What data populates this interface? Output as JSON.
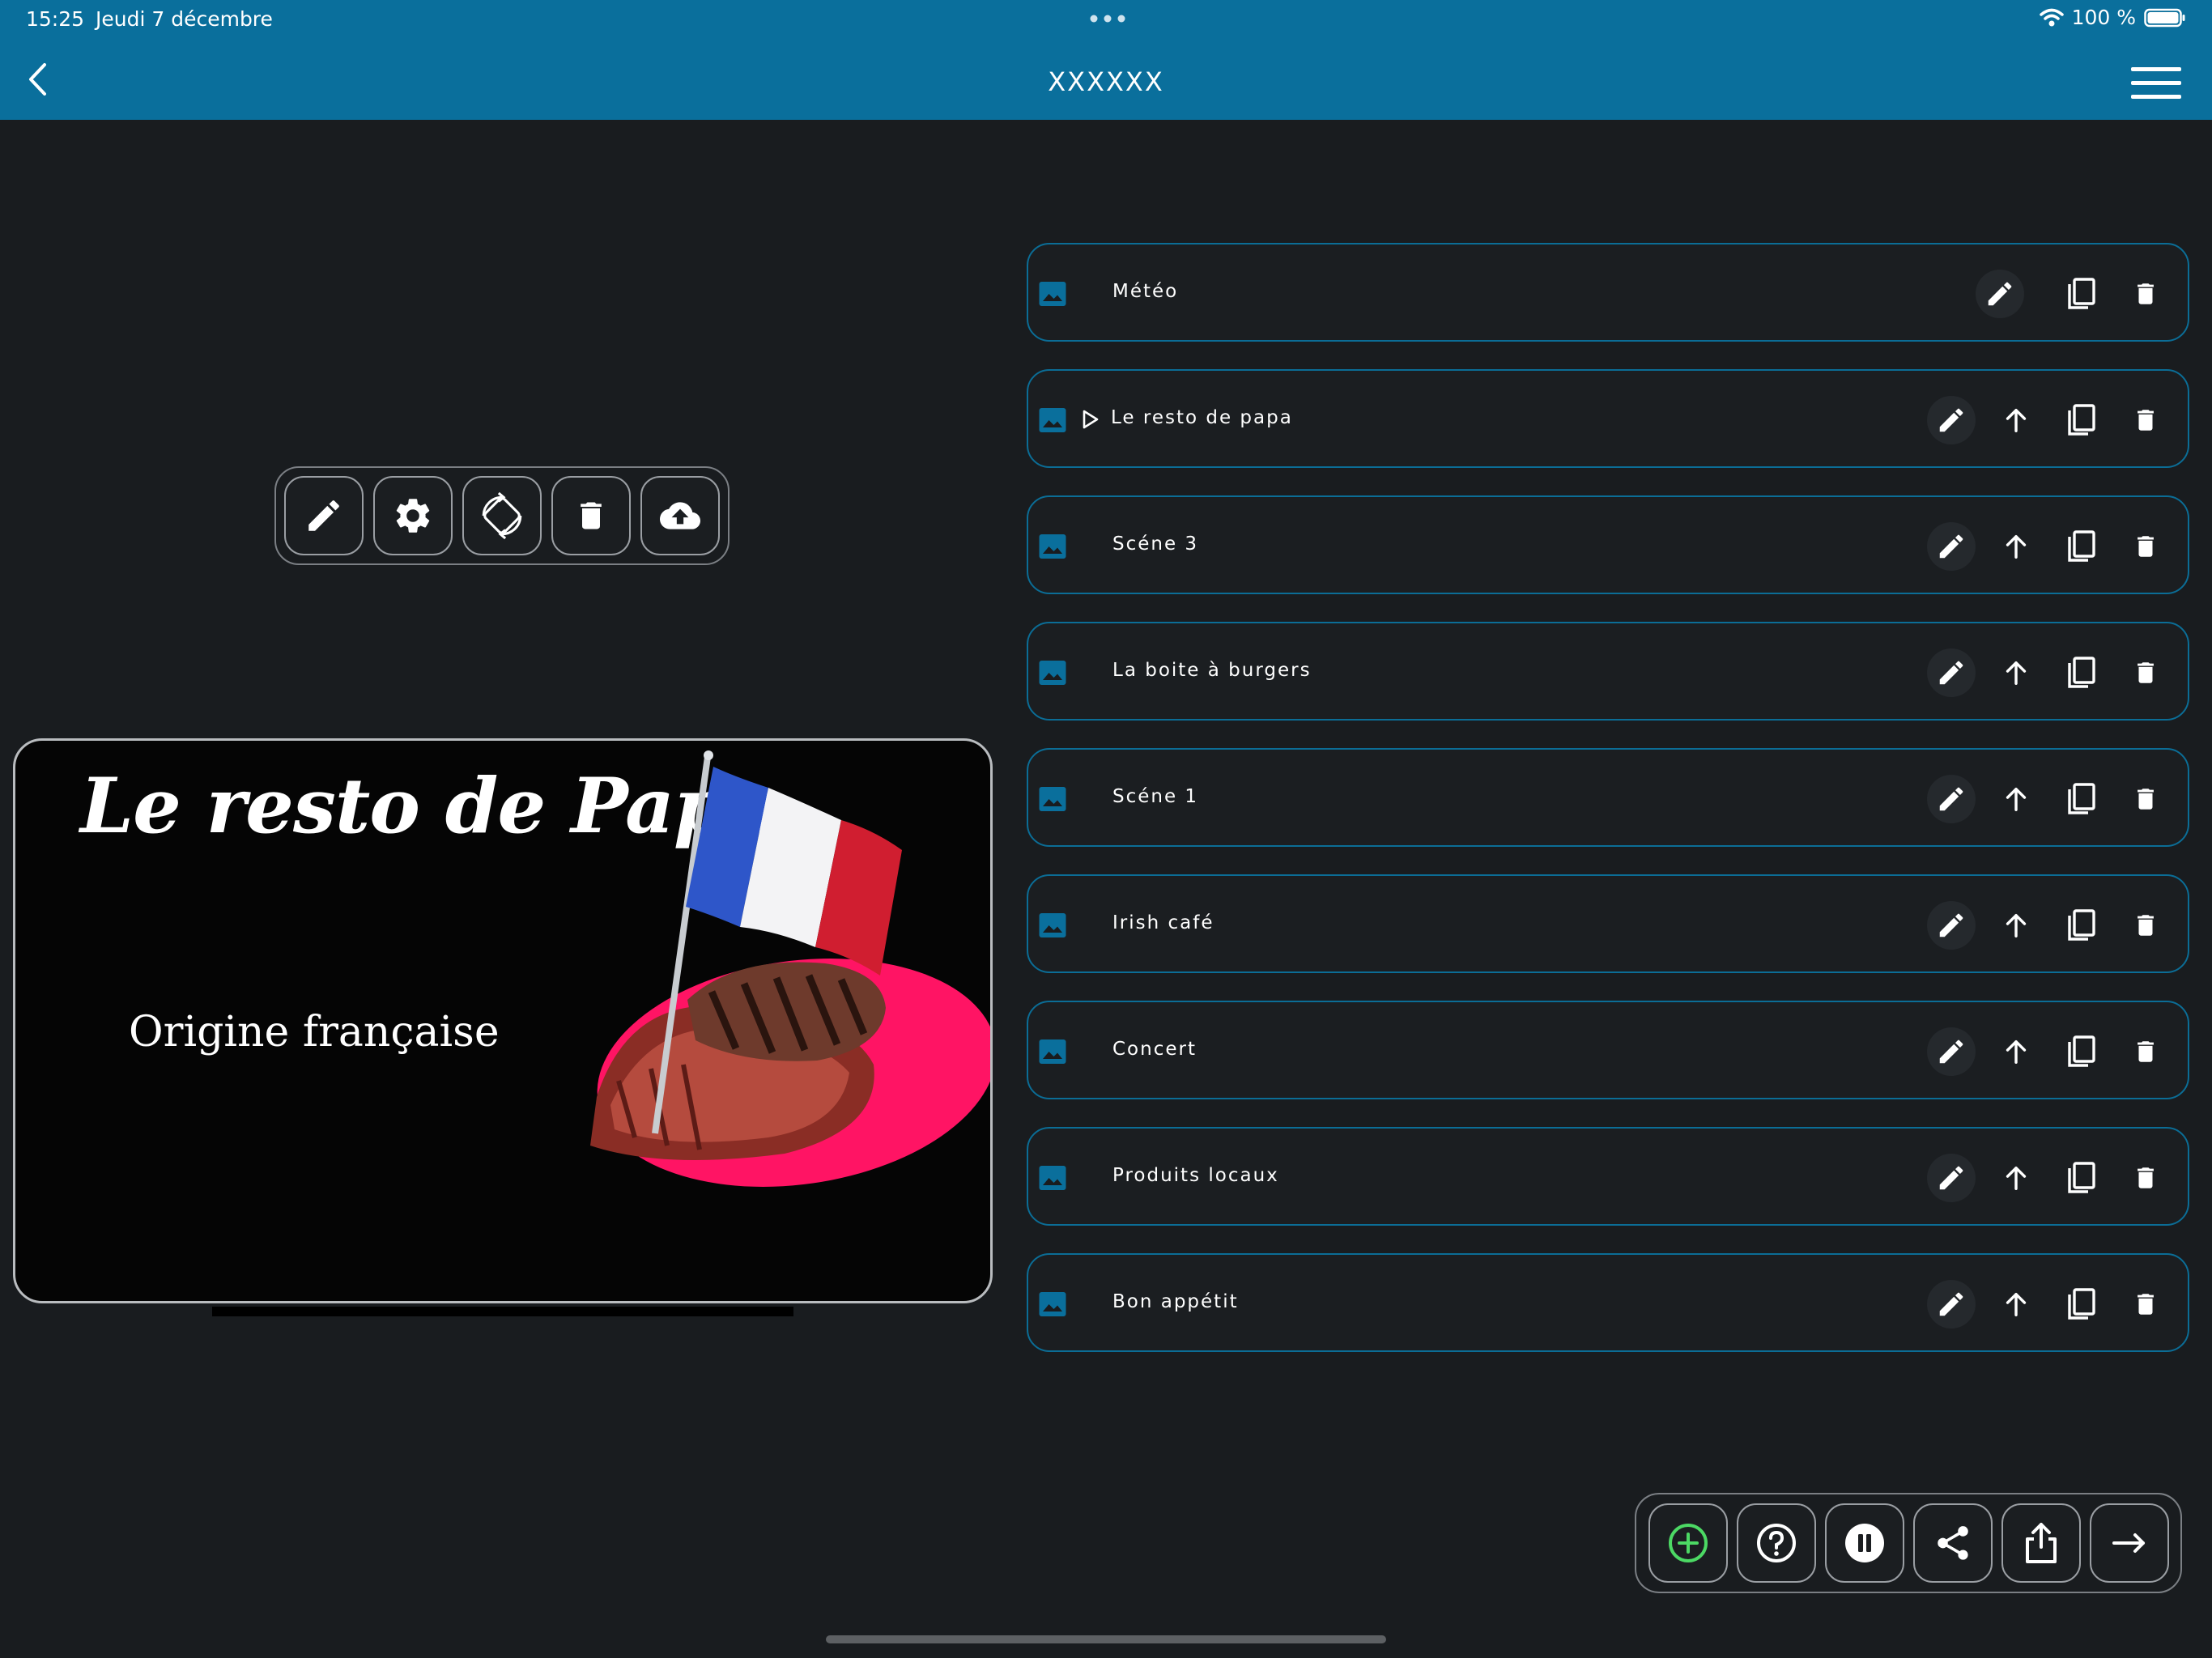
{
  "status_bar": {
    "time": "15:25",
    "date": "Jeudi 7 décembre",
    "battery": "100 %"
  },
  "nav": {
    "title": "XXXXXX"
  },
  "colors": {
    "accent": "#0a6f9c",
    "background": "#191c1f",
    "add_icon": "#4cd964",
    "preview_blob": "#ff1464"
  },
  "toolbar": {
    "icons": [
      "pencil-icon",
      "gear-icon",
      "rotate-icon",
      "trash-icon",
      "cloud-upload-icon"
    ]
  },
  "preview": {
    "title": "Le resto de Papa",
    "subtitle": "Origine française"
  },
  "scenes": [
    {
      "label": "Météo",
      "playing": false,
      "can_move_up": false
    },
    {
      "label": "Le resto de papa",
      "playing": true,
      "can_move_up": true
    },
    {
      "label": "Scéne 3",
      "playing": false,
      "can_move_up": true
    },
    {
      "label": "La boite à burgers",
      "playing": false,
      "can_move_up": true
    },
    {
      "label": "Scéne 1",
      "playing": false,
      "can_move_up": true
    },
    {
      "label": "Irish café",
      "playing": false,
      "can_move_up": true
    },
    {
      "label": "Concert",
      "playing": false,
      "can_move_up": true
    },
    {
      "label": "Produits locaux",
      "playing": false,
      "can_move_up": true
    },
    {
      "label": "Bon appétit",
      "playing": false,
      "can_move_up": true
    }
  ],
  "bottom_bar": {
    "icons": [
      "add-icon",
      "help-icon",
      "pause-icon",
      "share-icon",
      "export-icon",
      "arrow-right-icon"
    ]
  }
}
